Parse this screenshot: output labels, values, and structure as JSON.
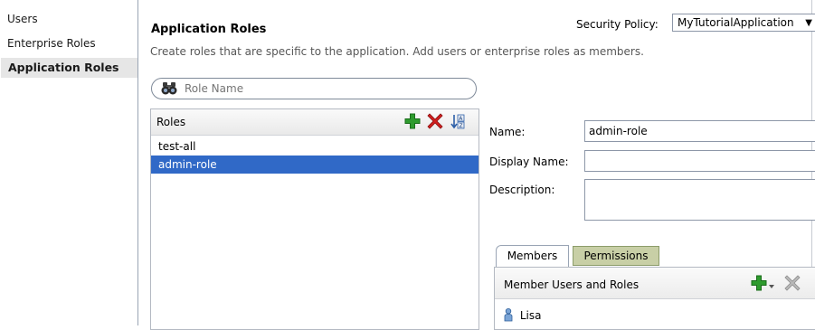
{
  "nav": {
    "items": [
      {
        "label": "Users"
      },
      {
        "label": "Enterprise Roles"
      },
      {
        "label": "Application Roles"
      }
    ]
  },
  "page": {
    "title": "Application Roles",
    "subtitle": "Create roles that are specific to the application.  Add users or enterprise roles as members."
  },
  "security_policy": {
    "label": "Security Policy:",
    "value": "MyTutorialApplication"
  },
  "search": {
    "placeholder": "Role Name"
  },
  "roles": {
    "header": "Roles",
    "items": [
      {
        "label": "test-all"
      },
      {
        "label": "admin-role"
      }
    ]
  },
  "details": {
    "name_label": "Name:",
    "name_value": "admin-role",
    "display_name_label": "Display Name:",
    "display_name_value": "",
    "description_label": "Description:",
    "description_value": ""
  },
  "tabs": [
    {
      "label": "Members"
    },
    {
      "label": "Permissions"
    }
  ],
  "members": {
    "header": "Member Users and Roles",
    "items": [
      {
        "label": "Lisa"
      }
    ]
  },
  "colors": {
    "selection": "#3069c7",
    "add_icon": "#2e9b2e",
    "delete_icon": "#d11e1e",
    "permissions_tab": "#c8cfa6"
  },
  "icons": [
    "binoculars-icon",
    "add-icon",
    "delete-icon",
    "sort-icon",
    "user-icon",
    "dropdown-arrow-icon"
  ]
}
